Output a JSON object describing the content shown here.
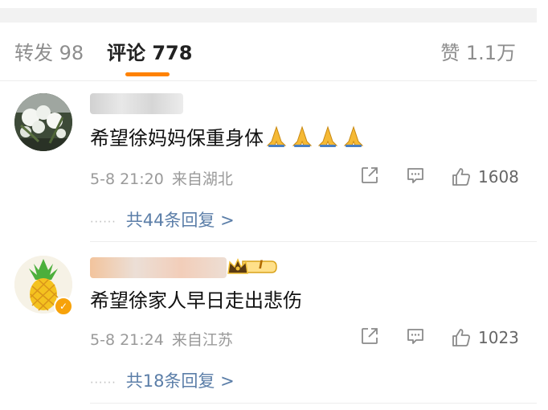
{
  "tabs": {
    "repost": "转发 98",
    "comment": "评论 778",
    "like": "赞 1.1万"
  },
  "comments": [
    {
      "username": "",
      "text": "希望徐妈妈保重身体",
      "emoji_icon": "folded-hands-icon",
      "time": "5-8 21:20",
      "location": "来自湖北",
      "likes": "1608",
      "replies_link": "共44条回复 >"
    },
    {
      "username": "",
      "text": "希望徐家人早日走出悲伤",
      "time": "5-8 21:24",
      "location": "来自江苏",
      "likes": "1023",
      "replies_link": "共18条回复 >",
      "fan_badge_text": "I"
    }
  ],
  "colors": {
    "accent": "#ff8200",
    "link": "#5b7ea8",
    "meta": "#9a9a9a"
  }
}
